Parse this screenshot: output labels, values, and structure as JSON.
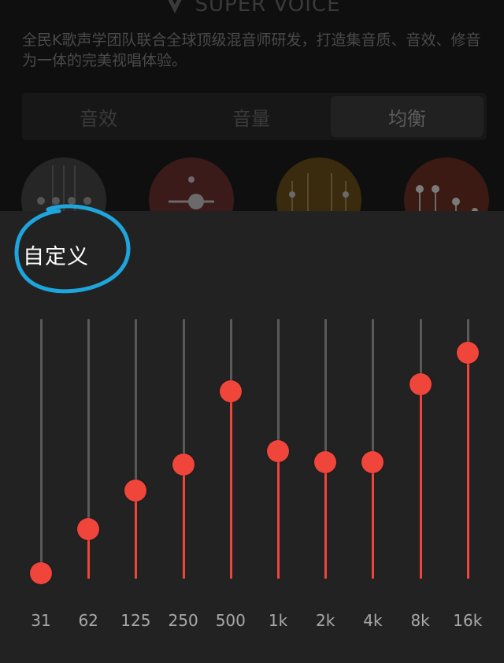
{
  "header": {
    "brand": "SUPER VOICE",
    "description": "全民K歌声学团队联合全球顶级混音师研发，打造集音质、音效、修音为一体的完美视唱体验。"
  },
  "tabs": [
    {
      "label": "音效",
      "active": false
    },
    {
      "label": "音量",
      "active": false
    },
    {
      "label": "均衡",
      "active": true
    }
  ],
  "presets": [
    {
      "name": "preset-gray",
      "color": "#262626"
    },
    {
      "name": "preset-red",
      "color": "#3a1b1a"
    },
    {
      "name": "preset-gold",
      "color": "#3a2b0e"
    },
    {
      "name": "preset-rust",
      "color": "#3a1a12"
    }
  ],
  "equalizer": {
    "title": "自定义",
    "accent_color": "#f0453a",
    "track_color": "#5a5a5a",
    "annotation_color": "#1ea5dc",
    "bands": [
      {
        "freq": "31",
        "level": 0.02
      },
      {
        "freq": "62",
        "level": 0.19
      },
      {
        "freq": "125",
        "level": 0.34
      },
      {
        "freq": "250",
        "level": 0.44
      },
      {
        "freq": "500",
        "level": 0.72
      },
      {
        "freq": "1k",
        "level": 0.49
      },
      {
        "freq": "2k",
        "level": 0.45
      },
      {
        "freq": "4k",
        "level": 0.45
      },
      {
        "freq": "8k",
        "level": 0.75
      },
      {
        "freq": "16k",
        "level": 0.87
      }
    ]
  }
}
